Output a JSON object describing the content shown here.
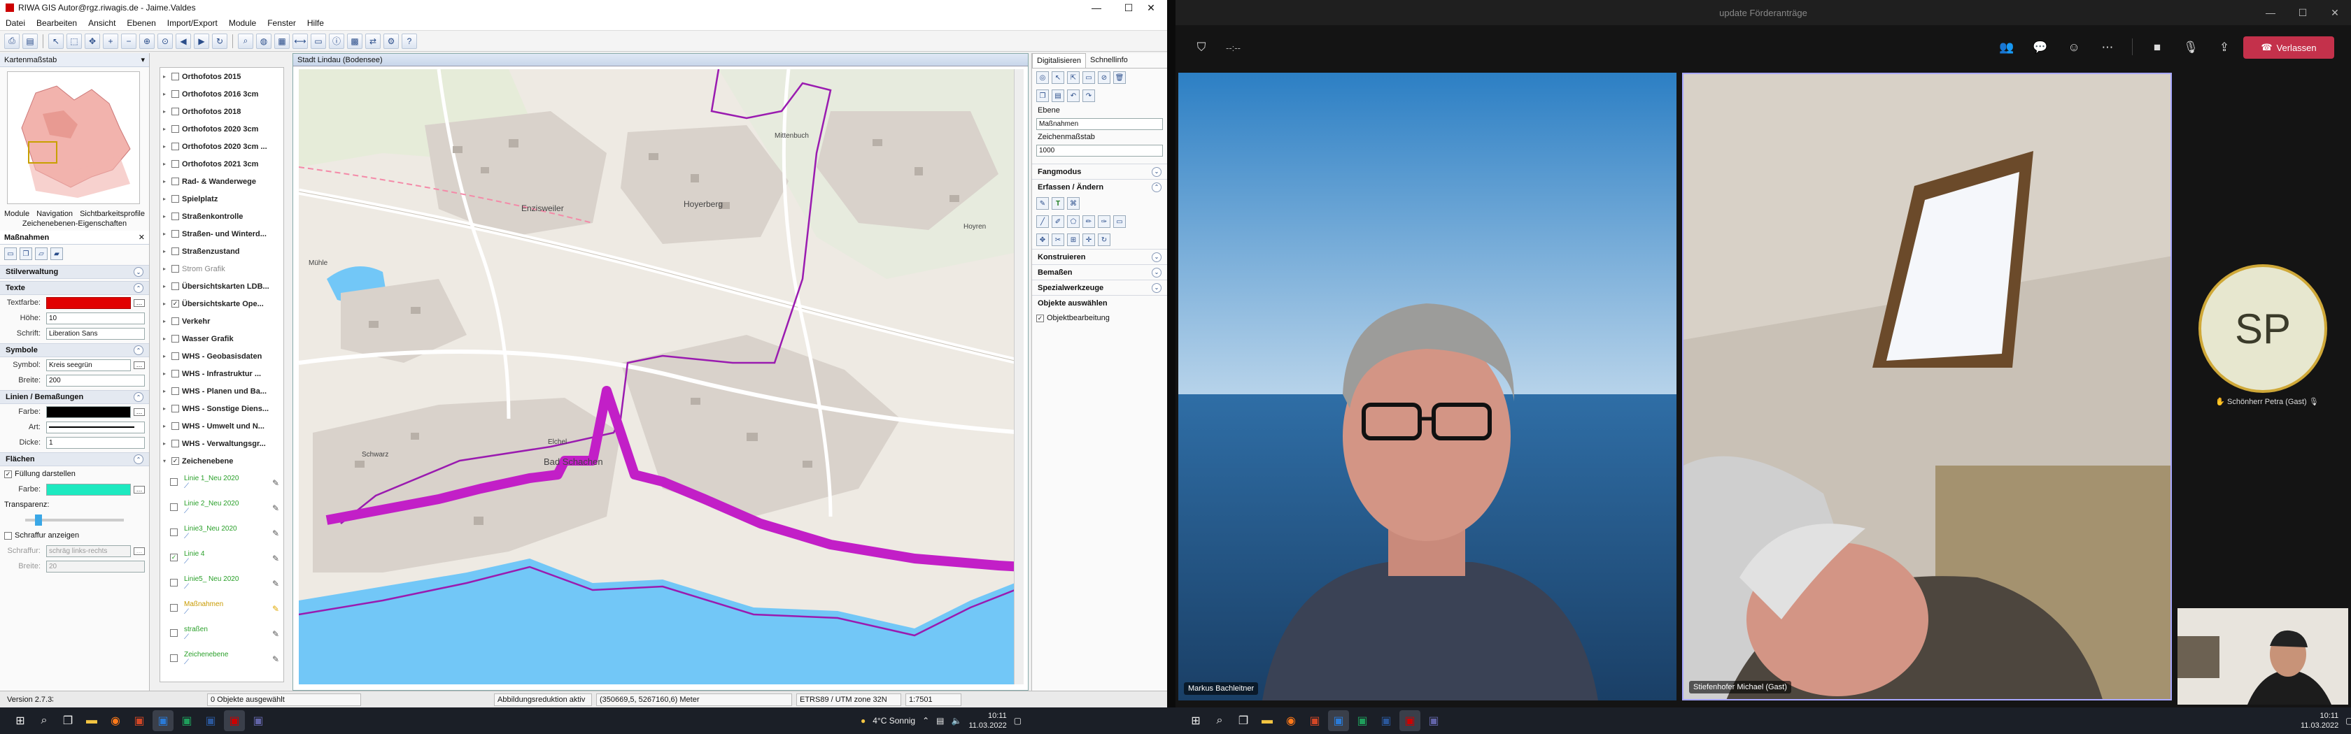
{
  "gis": {
    "title": "RIWA GIS Autor@rgz.riwagis.de - Jaime.Valdes",
    "menu": [
      "Datei",
      "Bearbeiten",
      "Ansicht",
      "Ebenen",
      "Import/Export",
      "Module",
      "Fenster",
      "Hilfe"
    ],
    "left_panel": {
      "map_scale_label": "Kartenmaßstab",
      "tabs": [
        "Module",
        "Navigation",
        "Sichtbarkeitsprofile"
      ],
      "sub_tab": "Zeichenebenen-Eigenschaften",
      "group_title": "Maßnahmen",
      "sections": {
        "style": "Stilverwaltung",
        "text": "Texte",
        "symbols": "Symbole",
        "lines": "Linien / Bemaßungen",
        "areas": "Flächen"
      },
      "text_color_label": "Textfarbe:",
      "height_label": "Höhe:",
      "height_value": "10",
      "font_label": "Schrift:",
      "font_value": "Liberation Sans",
      "symbol_label": "Symbol:",
      "symbol_value": "Kreis seegrün",
      "width_label": "Breite:",
      "width_value": "200",
      "color_label": "Farbe:",
      "type_label": "Art:",
      "thickness_label": "Dicke:",
      "thickness_value": "1",
      "fill_label": "Füllung darstellen",
      "fill_color_label": "Farbe:",
      "transparency_label": "Transparenz:",
      "hatch_label": "Schraffur anzeigen",
      "hatch_field_label": "Schraffur:",
      "hatch_value": "schräg links-rechts",
      "hatch_width_label": "Breite:",
      "hatch_width_value": "20"
    },
    "tree_layers": [
      {
        "label": "Orthofotos 2015",
        "checked": false
      },
      {
        "label": "Orthofotos 2016 3cm",
        "checked": false
      },
      {
        "label": "Orthofotos 2018",
        "checked": false
      },
      {
        "label": "Orthofotos 2020 3cm",
        "checked": false
      },
      {
        "label": "Orthofotos 2020 3cm ...",
        "checked": false
      },
      {
        "label": "Orthofotos 2021 3cm",
        "checked": false
      },
      {
        "label": "Rad- & Wanderwege",
        "checked": false
      },
      {
        "label": "Spielplatz",
        "checked": false
      },
      {
        "label": "Straßenkontrolle",
        "checked": false
      },
      {
        "label": "Straßen- und Winterd...",
        "checked": false
      },
      {
        "label": "Straßenzustand",
        "checked": false
      },
      {
        "label": "Strom Grafik",
        "checked": false,
        "grey": true
      },
      {
        "label": "Übersichtskarten LDB...",
        "checked": false
      },
      {
        "label": "Übersichtskarte Ope...",
        "checked": true
      },
      {
        "label": "Verkehr",
        "checked": false
      },
      {
        "label": "Wasser Grafik",
        "checked": false
      },
      {
        "label": "WHS - Geobasisdaten",
        "checked": false
      },
      {
        "label": "WHS - Infrastruktur ...",
        "checked": false
      },
      {
        "label": "WHS - Planen und Ba...",
        "checked": false
      },
      {
        "label": "WHS - Sonstige Diens...",
        "checked": false
      },
      {
        "label": "WHS - Umwelt und N...",
        "checked": false
      },
      {
        "label": "WHS - Verwaltungsgr...",
        "checked": false
      },
      {
        "label": "Zeichenebene",
        "checked": true
      }
    ],
    "sub_layers": [
      {
        "label": "Linie 1_Neu 2020",
        "checked": false
      },
      {
        "label": "Linie 2_Neu 2020",
        "checked": false
      },
      {
        "label": "Linie3_Neu 2020",
        "checked": false
      },
      {
        "label": "Linie 4",
        "checked": true
      },
      {
        "label": "Linie5_ Neu 2020",
        "checked": false
      },
      {
        "label": "Maßnahmen",
        "checked": false
      },
      {
        "label": "straßen",
        "checked": false
      },
      {
        "label": "Zeichenebene",
        "checked": false
      }
    ],
    "map_window_title": "Stadt Lindau (Bodensee)",
    "map_labels": {
      "enzisweiler": "Enzisweiler",
      "hoyerberg": "Hoyerberg",
      "mittenbuch": "Mittenbuch",
      "hoyren": "Hoyren",
      "muhle": "Mühle",
      "schwarzer": "Schwarz",
      "bad_schachen": "Bad Schachen",
      "elchel": "Elchel"
    },
    "right_panel": {
      "tabs": [
        "Digitalisieren",
        "Schnellinfo"
      ],
      "layer_label": "Ebene",
      "layer_value": "Maßnahmen",
      "scale_label": "Zeichenmaßstab",
      "scale_value": "1000",
      "sections": [
        "Fangmodus",
        "Erfassen / Ändern",
        "Konstruieren",
        "Bemaßen",
        "Spezialwerkzeuge",
        "Objekte auswählen"
      ],
      "object_edit_label": "Objektbearbeitung"
    },
    "status": {
      "version": "Version 2.7.33",
      "selected": "0 Objekte ausgewählt",
      "reduction": "Abbildungsreduktion aktiv",
      "coords": "(350669,5, 5267160,6) Meter",
      "crs": "ETRS89 / UTM zone 32N",
      "scale": "1:7501"
    }
  },
  "taskbar": {
    "weather": "4°C  Sonnig",
    "time": "10:11",
    "date": "11.03.2022"
  },
  "teams": {
    "title": "update Förderanträge",
    "timer": "--:--",
    "leave_label": "Verlassen",
    "participants": [
      {
        "name": "Markus Bachleitner"
      },
      {
        "name": "Stiefenhofer Michael (Gast)"
      }
    ],
    "avatar": {
      "initials": "SP",
      "name": "Schönherr Petra (Gast)"
    }
  },
  "colors": {
    "route": "#c21fc7",
    "water": "#72c7f7",
    "ortho_text": "#222",
    "new_layer_green": "#2aa02a",
    "leave": "#c4314b"
  }
}
